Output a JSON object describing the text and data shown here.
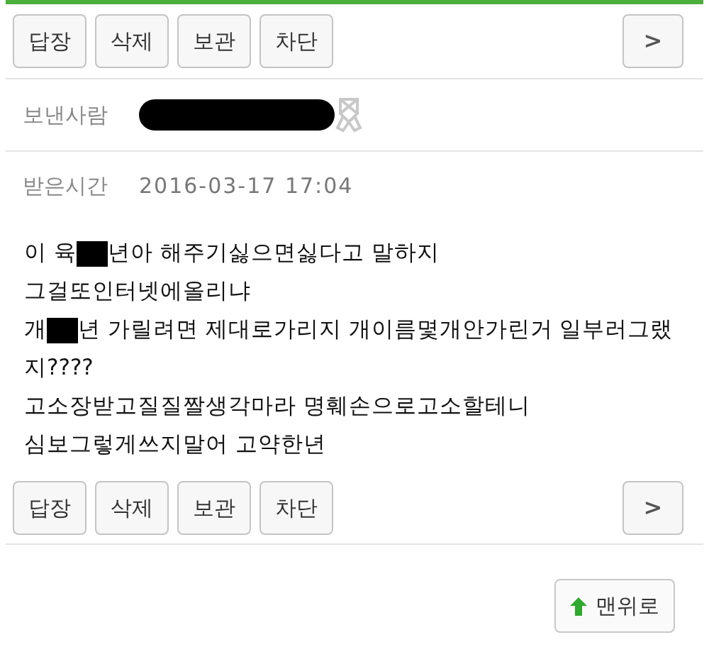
{
  "toolbar_top": {
    "buttons": [
      "답장",
      "삭제",
      "보관",
      "차단"
    ],
    "next": ">"
  },
  "sender": {
    "label": "보낸사람",
    "redacted": true
  },
  "received": {
    "label": "받은시간",
    "value": "2016-03-17 17:04"
  },
  "message_lines": [
    [
      {
        "kind": "text",
        "text": "이 육"
      },
      {
        "kind": "redaction"
      },
      {
        "kind": "text",
        "text": "년아 해주기싫으면싫다고 말하지"
      }
    ],
    [
      {
        "kind": "text",
        "text": "그걸또인터넷에올리냐"
      }
    ],
    [
      {
        "kind": "text",
        "text": "개"
      },
      {
        "kind": "redaction"
      },
      {
        "kind": "text",
        "text": "년 가릴려면 제대로가리지 개이름몇개안가린거 일부러그랬"
      }
    ],
    [
      {
        "kind": "text",
        "text": "지????"
      }
    ],
    [
      {
        "kind": "text",
        "text": "고소장받고질질짤생각마라 명훼손으로고소할테니"
      }
    ],
    [
      {
        "kind": "text",
        "text": "심보그렇게쓰지말어 고약한년"
      }
    ]
  ],
  "toolbar_bottom": {
    "buttons": [
      "답장",
      "삭제",
      "보관",
      "차단"
    ],
    "next": ">"
  },
  "top_button": {
    "label": "맨위로"
  }
}
